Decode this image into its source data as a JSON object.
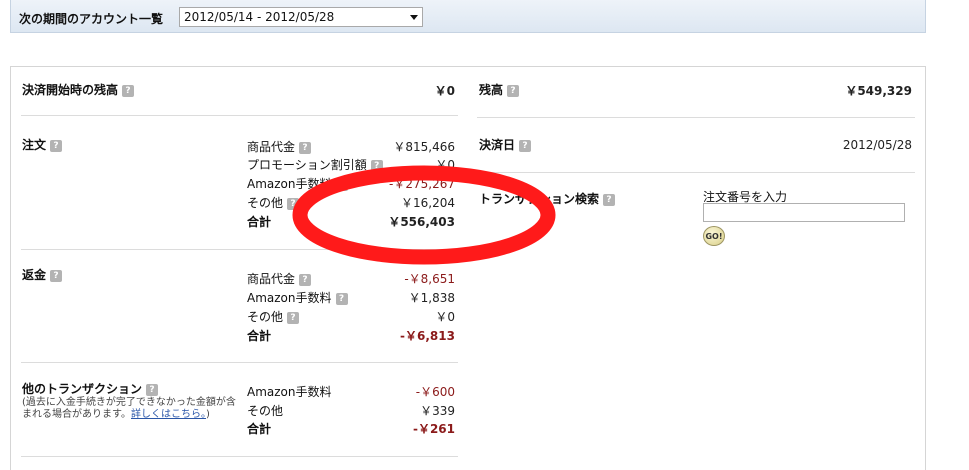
{
  "period": {
    "label": "次の期間のアカウント一覧",
    "selected": "2012/05/14 - 2012/05/28"
  },
  "help_glyph": "?",
  "start_balance": {
    "label": "決済開始時の残高",
    "value": "￥0"
  },
  "orders": {
    "title": "注文",
    "rows": [
      {
        "label": "商品代金",
        "value": "￥815,466"
      },
      {
        "label": "プロモーション割引額",
        "value": "￥0"
      },
      {
        "label": "Amazon手数料",
        "value": "-￥275,267"
      },
      {
        "label": "その他",
        "value": "￥16,204"
      }
    ],
    "total_label": "合計",
    "total_value": "￥556,403"
  },
  "refunds": {
    "title": "返金",
    "rows": [
      {
        "label": "商品代金",
        "value": "-￥8,651"
      },
      {
        "label": "Amazon手数料",
        "value": "￥1,838"
      },
      {
        "label": "その他",
        "value": "￥0"
      }
    ],
    "total_label": "合計",
    "total_value": "-￥6,813"
  },
  "other_tx": {
    "title": "他のトランザクション",
    "note_prefix": "(過去に入金手続きが完了できなかった金額が含まれる場合があります。",
    "note_link": "詳しくはこちら。",
    "note_suffix": ")",
    "rows": [
      {
        "label": "Amazon手数料",
        "value": "-￥600"
      },
      {
        "label": "その他",
        "value": "￥339"
      }
    ],
    "total_label": "合計",
    "total_value": "-￥261"
  },
  "balance": {
    "label": "残高",
    "value": "￥549,329"
  },
  "settlement_date": {
    "label": "決済日",
    "value": "2012/05/28"
  },
  "tx_search": {
    "label": "トランザクション検索",
    "input_label": "注文番号を入力",
    "input_value": "",
    "go_label": "GO!"
  },
  "colors": {
    "negative": "#8b1a1a",
    "annotation": "#ff1a1a"
  }
}
